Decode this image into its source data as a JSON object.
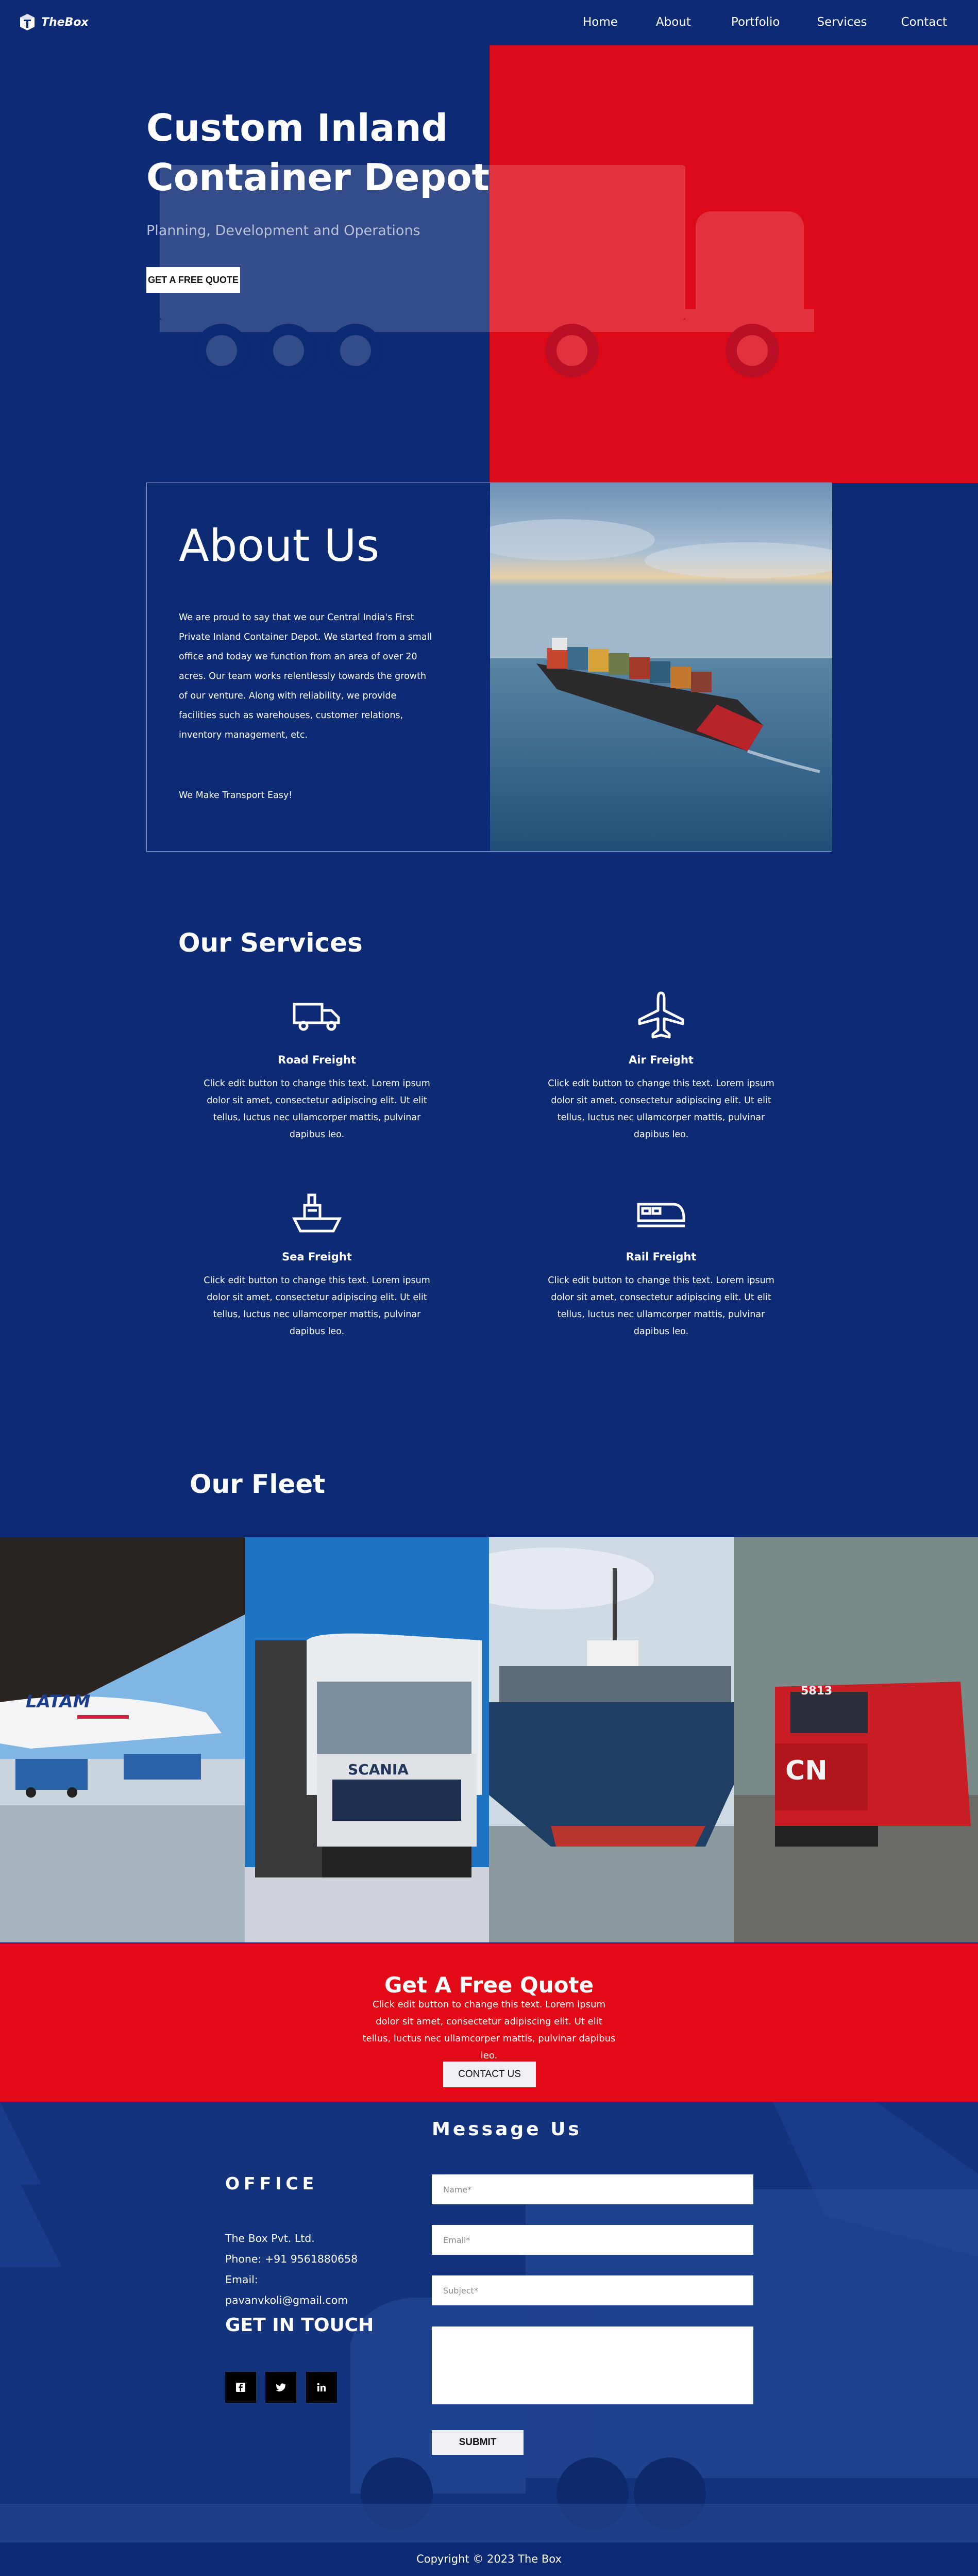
{
  "brand": {
    "name": "TheBox",
    "logo_icon": "cube-icon"
  },
  "nav": {
    "items": [
      "Home",
      "About",
      "Portfolio",
      "Services",
      "Contact"
    ]
  },
  "hero": {
    "title": "Custom Inland Container Depot",
    "subtitle": "Planning, Development and Operations",
    "cta": "GET A FREE QUOTE",
    "accent": "#dc0a19",
    "background": "#0d2a74"
  },
  "about": {
    "title": "About Us",
    "paragraph": "We are proud to say that we our Central India's First Private Inland Container Depot. We started from a small office and today we function from an area of over 20 acres. Our team works relentlessly towards the growth of our venture. Along with reliability, we provide facilities such as warehouses, customer relations, inventory management, etc.",
    "tagline": "We Make Transport Easy!",
    "image": "container-ship-photo"
  },
  "services": {
    "title": "Our Services",
    "items": [
      {
        "name": "Road Freight",
        "icon": "truck-icon",
        "text": "Click edit button to change this text. Lorem ipsum dolor sit amet, consectetur adipiscing elit. Ut elit tellus, luctus nec ullamcorper mattis, pulvinar dapibus leo."
      },
      {
        "name": "Air Freight",
        "icon": "plane-icon",
        "text": "Click edit button to change this text. Lorem ipsum dolor sit amet, consectetur adipiscing elit. Ut elit tellus, luctus nec ullamcorper mattis, pulvinar dapibus leo."
      },
      {
        "name": "Sea Freight",
        "icon": "ship-icon",
        "text": "Click edit button to change this text. Lorem ipsum dolor sit amet, consectetur adipiscing elit. Ut elit tellus, luctus nec ullamcorper mattis, pulvinar dapibus leo."
      },
      {
        "name": "Rail Freight",
        "icon": "train-icon",
        "text": "Click edit button to change this text. Lorem ipsum dolor sit amet, consectetur adipiscing elit. Ut elit tellus, luctus nec ullamcorper mattis, pulvinar dapibus leo."
      }
    ]
  },
  "fleet": {
    "title": "Our Fleet",
    "images": [
      "airplane-photo",
      "truck-photo",
      "cargo-ship-photo",
      "locomotive-photo"
    ],
    "airline_text": "LATAM",
    "truck_text": "SCANIA",
    "train_number": "5813",
    "train_logo": "CN"
  },
  "quote": {
    "title": "Get A Free Quote",
    "text": "Click edit button to change this text. Lorem ipsum dolor sit amet, consectetur adipiscing elit. Ut elit tellus, luctus nec ullamcorper mattis, pulvinar dapibus leo.",
    "cta": "CONTACT US",
    "accent": "#e10a16"
  },
  "contact": {
    "office_title": "OFFICE",
    "company": "The Box Pvt. Ltd.",
    "phone_email": "Phone: +91 9561880658 Email:",
    "email": "pavanvkoli@gmail.com",
    "touch_title": "GET IN TOUCH",
    "social": [
      "facebook-icon",
      "twitter-icon",
      "linkedin-icon"
    ],
    "form_title": "Message Us",
    "name_placeholder": "Name*",
    "email_placeholder": "Email*",
    "subject_placeholder": "Subject*",
    "message_placeholder": "",
    "submit": "SUBMIT"
  },
  "footer": {
    "copyright": "Copyright © 2023 The Box"
  }
}
